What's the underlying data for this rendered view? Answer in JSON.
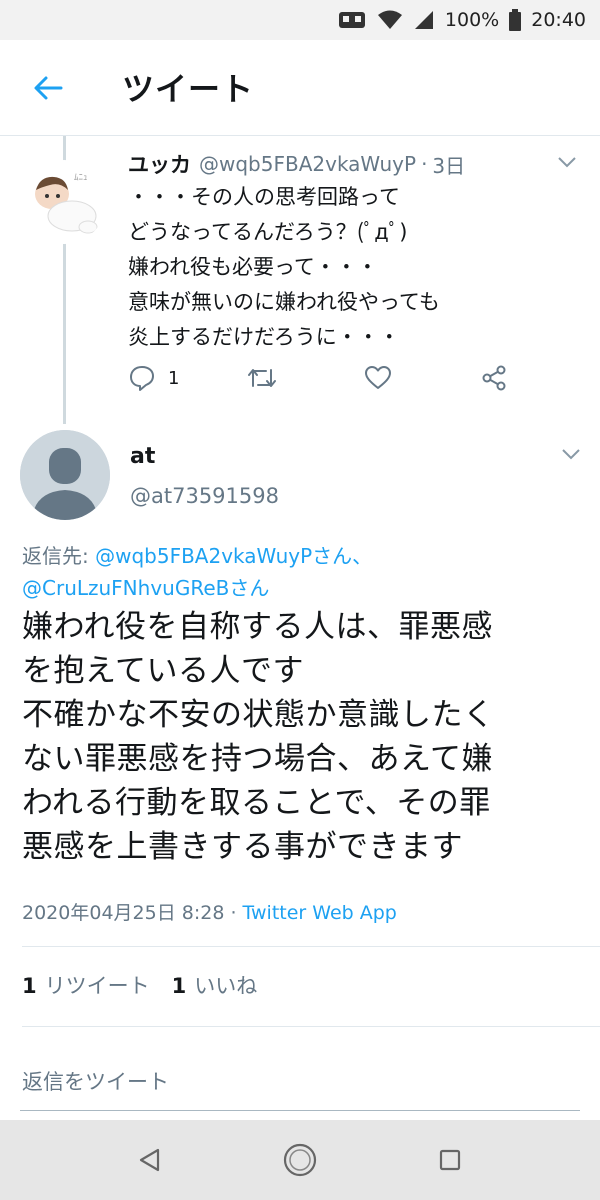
{
  "status_bar": {
    "battery_text": "100%",
    "time": "20:40"
  },
  "app_bar": {
    "title": "ツイート",
    "back_icon": "arrow-left-icon"
  },
  "parent_tweet": {
    "name": "ユッカ",
    "handle": "@wqb5FBA2vkaWuyP",
    "separator": "·",
    "time": "3日",
    "text": "・・・その人の思考回路って\nどうなってるんだろう？(ﾟдﾟ)\n嫌われ役も必要って・・・\n意味が無いのに嫌われ役やっても\n炎上するだけだろうに・・・",
    "reply_count": "1"
  },
  "main_tweet": {
    "name": "at",
    "handle": "@at73591598",
    "reply_prefix": "返信先: ",
    "mention1": "@wqb5FBA2vkaWuyPさん、",
    "mention2": "@CruLzuFNhvuGReBさん",
    "text": "嫌われ役を自称する人は、罪悪感\nを抱えている人です\n不確かな不安の状態か意識したく\nない罪悪感を持つ場合、あえて嫌\nわれる行動を取ることで、その罪\n悪感を上書きする事ができます",
    "timestamp": "2020年04月25日 8:28",
    "meta_separator": " · ",
    "source": "Twitter Web App",
    "retweet_count": "1",
    "retweet_label": "リツイート",
    "like_count": "1",
    "like_label": "いいね"
  },
  "reply_box": {
    "placeholder": "返信をツイート"
  },
  "colors": {
    "accent": "#1da1f2",
    "secondary_text": "#657786",
    "divider": "#e1e8ed"
  }
}
